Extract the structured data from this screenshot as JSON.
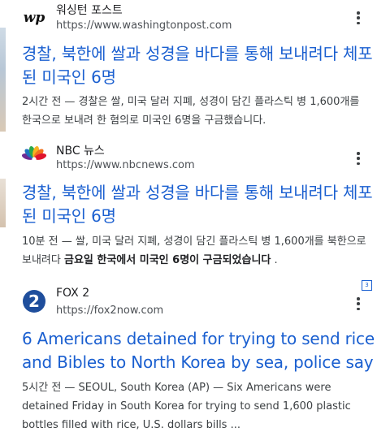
{
  "results": [
    {
      "site_name": "워싱턴 포스트",
      "url": "https://www.washingtonpost.com",
      "logo_text": "wp",
      "icon": "washington-post-logo",
      "title": "경찰, 북한에 쌀과 성경을 바다를 통해 보내려다 체포된 미국인 6명",
      "snippet": "2시간 전 — 경찰은 쌀, 미국 달러 지폐, 성경이 담긴 플라스틱 병 1,600개를 한국으로 보내려 한 혐의로 미국인 6명을 구금했습니다."
    },
    {
      "site_name": "NBC 뉴스",
      "url": "https://www.nbcnews.com",
      "icon": "nbc-peacock-logo",
      "title": "경찰, 북한에 쌀과 성경을 바다를 통해 보내려다 체포된 미국인 6명",
      "snippet_prefix": "10분 전 — 쌀, 미국 달러 지폐, 성경이 담긴 플라스틱 병 1,600개를 북한으로 보내려다 ",
      "snippet_bold": "금요일 한국에서 미국인 6명이 구금되었습니다",
      "snippet_suffix": " ."
    },
    {
      "site_name": "FOX 2",
      "url": "https://fox2now.com",
      "logo_text": "2",
      "icon": "fox2-logo",
      "title": "6 Americans detained for trying to send rice and Bibles to North Korea by sea, police say",
      "snippet": "5시간 전 — SEOUL, South Korea (AP) — Six Americans were detained Friday in South Korea for trying to send 1,600 plastic bottles filled with rice, U.S. dollars bills ..."
    }
  ],
  "badge_text": "3",
  "colors": {
    "link": "#1a5fd0",
    "text": "#202124",
    "url": "#4d5156",
    "snippet": "#3c4043",
    "fox_blue": "#1f4e9c"
  }
}
